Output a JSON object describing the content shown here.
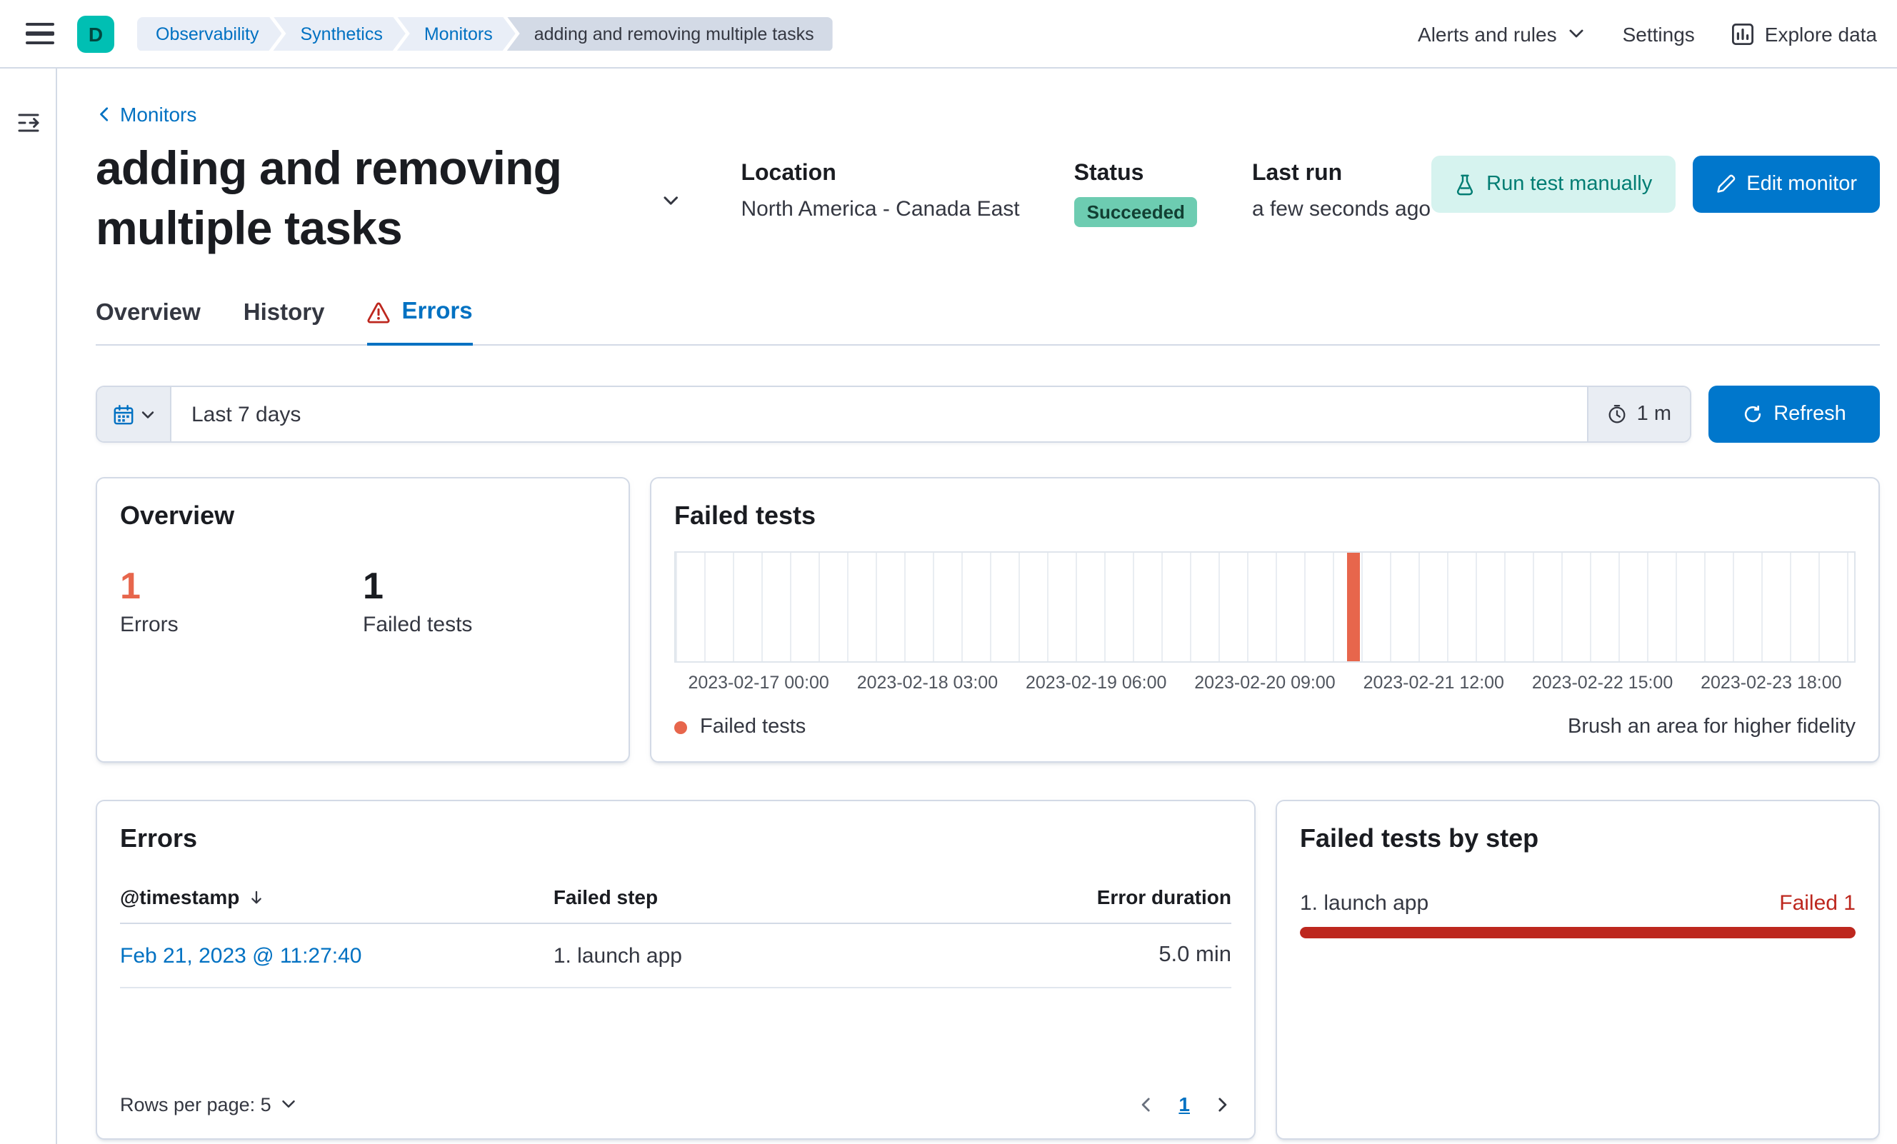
{
  "colors": {
    "primary": "#0077cc",
    "link": "#0071c2",
    "danger": "#bd271e",
    "vis_red": "#e7664c",
    "success_badge": "#6dccb1",
    "logo_teal": "#00bfb3"
  },
  "header": {
    "logo_letter": "D",
    "breadcrumbs": [
      "Observability",
      "Synthetics",
      "Monitors",
      "adding and removing multiple tasks"
    ],
    "nav": {
      "alerts": "Alerts and rules",
      "settings": "Settings",
      "explore": "Explore data"
    }
  },
  "page": {
    "back_link": "Monitors",
    "title": "adding and removing multiple tasks",
    "meta": {
      "location_label": "Location",
      "location_value": "North America - Canada East",
      "status_label": "Status",
      "status_value": "Succeeded",
      "last_run_label": "Last run",
      "last_run_value": "a few seconds ago"
    },
    "actions": {
      "run_test": "Run test manually",
      "edit": "Edit monitor"
    }
  },
  "tabs": [
    {
      "label": "Overview",
      "active": false
    },
    {
      "label": "History",
      "active": false
    },
    {
      "label": "Errors",
      "active": true
    }
  ],
  "datebar": {
    "range": "Last 7 days",
    "interval": "1 m",
    "refresh_label": "Refresh"
  },
  "overview_panel": {
    "title": "Overview",
    "stats": [
      {
        "value": "1",
        "label": "Errors",
        "color": "#e7664c"
      },
      {
        "value": "1",
        "label": "Failed tests",
        "color": "#1a1c21"
      }
    ]
  },
  "failed_tests_panel": {
    "title": "Failed tests",
    "legend_label": "Failed tests",
    "hint": "Brush an area for higher fidelity",
    "chart_data": {
      "type": "bar",
      "title": "Failed tests",
      "x_ticks": [
        "2023-02-17 00:00",
        "2023-02-18 03:00",
        "2023-02-19 06:00",
        "2023-02-20 09:00",
        "2023-02-21 12:00",
        "2023-02-22 15:00",
        "2023-02-23 18:00"
      ],
      "series": [
        {
          "name": "Failed tests",
          "points": [
            {
              "x": "2023-02-21 11:27",
              "y": 1
            }
          ]
        }
      ],
      "ylim": [
        0,
        1
      ],
      "bar_color": "#e7664c",
      "bar_position_fraction": 0.57,
      "grid": true,
      "legend_position": "bottom-left"
    }
  },
  "errors_panel": {
    "title": "Errors",
    "columns": [
      "@timestamp",
      "Failed step",
      "Error duration"
    ],
    "rows": [
      {
        "timestamp": "Feb 21, 2023 @ 11:27:40",
        "failed_step": "1. launch app",
        "error_duration": "5.0 min"
      }
    ],
    "footer": {
      "rows_per_page": "Rows per page: 5",
      "page": "1"
    }
  },
  "failed_by_step_panel": {
    "title": "Failed tests by step",
    "steps": [
      {
        "label": "1. launch app",
        "badge": "Failed 1",
        "value": 1,
        "max": 1
      }
    ]
  }
}
